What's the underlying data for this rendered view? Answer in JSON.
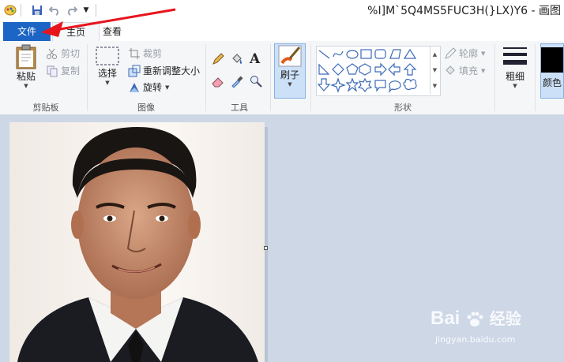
{
  "window": {
    "title": "%I]M`5Q4MS5FUC3H(}LX)Y6 - 画图"
  },
  "tabs": [
    {
      "label": "文件"
    },
    {
      "label": "主页"
    },
    {
      "label": "查看"
    }
  ],
  "ribbon": {
    "clipboard": {
      "paste": "粘贴",
      "cut": "剪切",
      "copy": "复制",
      "label": "剪贴板"
    },
    "image": {
      "select": "选择",
      "crop": "裁剪",
      "resize": "重新调整大小",
      "rotate": "旋转",
      "label": "图像"
    },
    "tools": {
      "label": "工具",
      "text_glyph": "A"
    },
    "brushes": {
      "label": "刷子"
    },
    "shapes": {
      "outline": "轮廓",
      "fill": "填充",
      "label": "形状"
    },
    "size": {
      "label": "粗细"
    },
    "colors": {
      "label": "颜色"
    }
  },
  "watermark": {
    "brand": "Bai",
    "brand2": "经验",
    "url": "jingyan.baidu.com"
  },
  "colors": {
    "accent": "#1d65c4",
    "arrow": "#e8141c",
    "canvas_bg": "#cdd7e6"
  }
}
